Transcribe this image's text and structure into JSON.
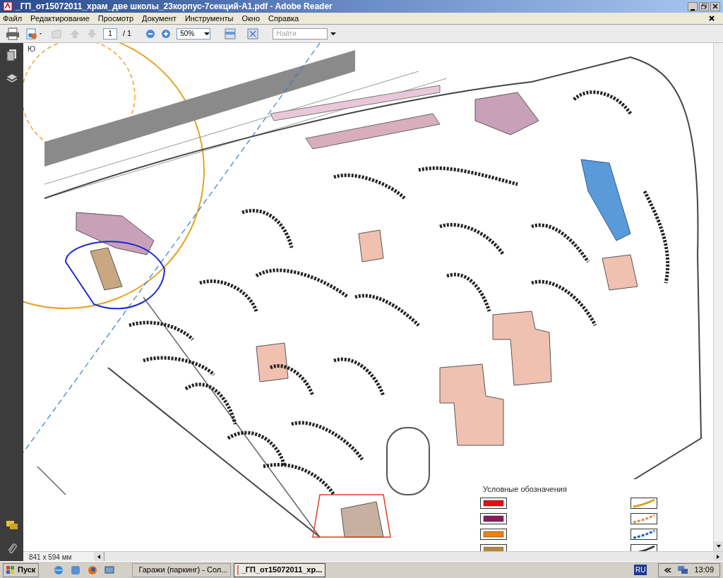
{
  "window": {
    "title": "_ГП_от15072011_храм_две школы_23корпус-7секций-А1.pdf - Adobe Reader"
  },
  "menu": [
    "Файл",
    "Редактирование",
    "Просмотр",
    "Документ",
    "Инструменты",
    "Окно",
    "Справка"
  ],
  "toolbar": {
    "page": "1",
    "page_count": "/ 1",
    "zoom": "50%",
    "find_placeholder": "Найти"
  },
  "document": {
    "compass_label": "Ю",
    "legend": {
      "title": "Условные обозначения",
      "items": [
        {
          "kind": "fill",
          "color": "#e01010"
        },
        {
          "kind": "fill",
          "color": "#8a1a5c"
        },
        {
          "kind": "fill",
          "color": "#f08010"
        },
        {
          "kind": "hatch",
          "color": "#b08840"
        },
        {
          "kind": "line",
          "color": "#d8a020"
        },
        {
          "kind": "dashed",
          "color": "#e09040"
        },
        {
          "kind": "dashed",
          "color": "#2060d0"
        },
        {
          "kind": "line",
          "color": "#404040"
        }
      ]
    }
  },
  "status": {
    "page_size": "841 x 594 мм"
  },
  "taskbar": {
    "start": "Пуск",
    "tasks": [
      {
        "label": "Гаражи (паркинг) - Сол...",
        "selected": false
      },
      {
        "label": "_ГП_от15072011_хр...",
        "selected": true
      }
    ],
    "language": "RU",
    "clock": "13:09"
  }
}
